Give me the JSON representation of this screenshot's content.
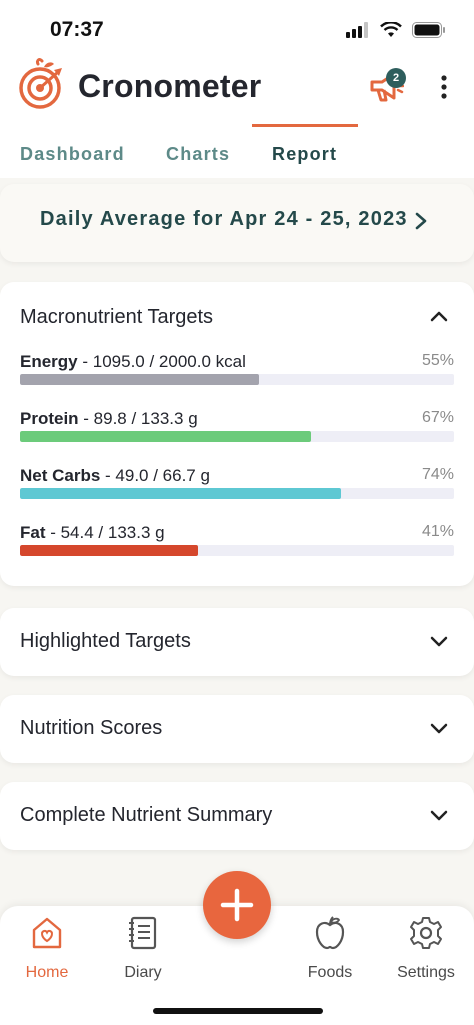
{
  "status_bar": {
    "time": "07:37"
  },
  "header": {
    "app_name": "Cronometer",
    "notification_count": "2"
  },
  "tabs": [
    {
      "label": "Dashboard"
    },
    {
      "label": "Charts"
    },
    {
      "label": "Report"
    }
  ],
  "active_tab": "Report",
  "date_range": "Daily Average for Apr 24 - 25, 2023",
  "macro_section": {
    "title": "Macronutrient Targets",
    "items": [
      {
        "name": "Energy",
        "detail": " - 1095.0 / 2000.0 kcal",
        "percent": "55%",
        "fraction": 0.55,
        "color": "#a3a3ad"
      },
      {
        "name": "Protein",
        "detail": " - 89.8 / 133.3 g",
        "percent": "67%",
        "fraction": 0.67,
        "color": "#6ccb7b"
      },
      {
        "name": "Net Carbs",
        "detail": " - 49.0 / 66.7 g",
        "percent": "74%",
        "fraction": 0.74,
        "color": "#5ec8d3"
      },
      {
        "name": "Fat",
        "detail": " - 54.4 / 133.3 g",
        "percent": "41%",
        "fraction": 0.41,
        "color": "#d5472c"
      }
    ]
  },
  "sections": [
    {
      "title": "Highlighted Targets"
    },
    {
      "title": "Nutrition Scores"
    },
    {
      "title": "Complete Nutrient Summary"
    }
  ],
  "bottom_nav": [
    {
      "label": "Home",
      "icon": "home-icon"
    },
    {
      "label": "Diary",
      "icon": "diary-icon"
    },
    {
      "label": "Foods",
      "icon": "apple-icon"
    },
    {
      "label": "Settings",
      "icon": "gear-icon"
    }
  ],
  "accent_color": "#e3683f"
}
